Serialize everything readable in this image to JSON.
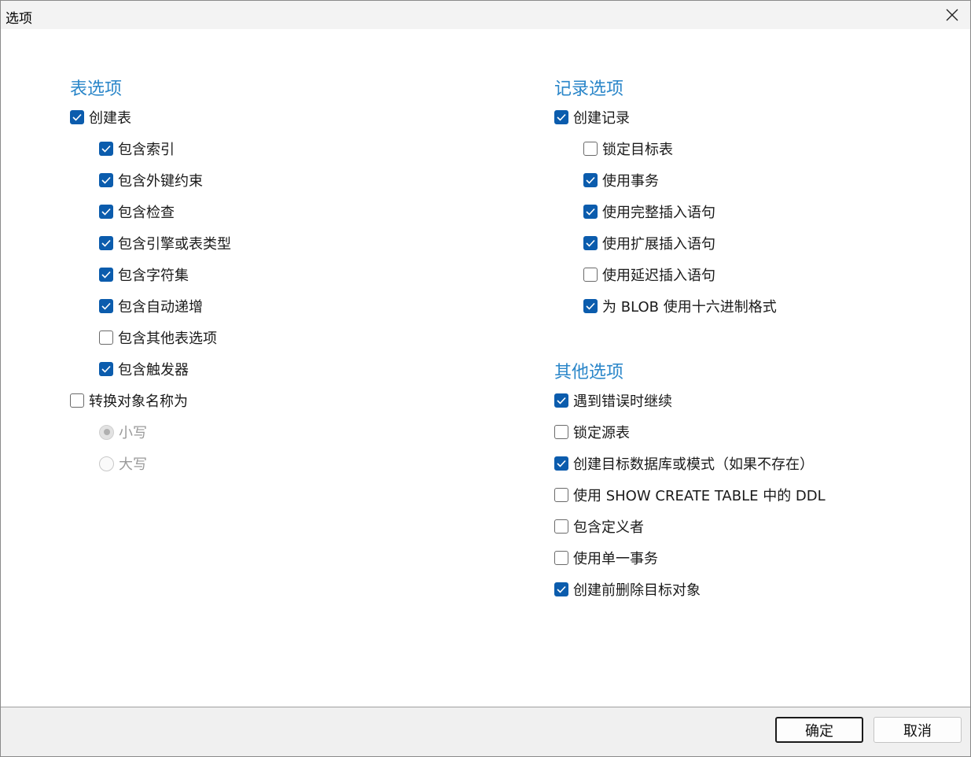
{
  "window": {
    "title": "选项"
  },
  "table_options": {
    "title": "表选项",
    "create_table": {
      "label": "创建表",
      "checked": true
    },
    "sub": [
      {
        "label": "包含索引",
        "checked": true
      },
      {
        "label": "包含外键约束",
        "checked": true
      },
      {
        "label": "包含检查",
        "checked": true
      },
      {
        "label": "包含引擎或表类型",
        "checked": true
      },
      {
        "label": "包含字符集",
        "checked": true
      },
      {
        "label": "包含自动递增",
        "checked": true
      },
      {
        "label": "包含其他表选项",
        "checked": false
      },
      {
        "label": "包含触发器",
        "checked": true
      }
    ],
    "convert_names": {
      "label": "转换对象名称为",
      "checked": false
    },
    "case_options": [
      {
        "label": "小写",
        "selected": true
      },
      {
        "label": "大写",
        "selected": false
      }
    ]
  },
  "record_options": {
    "title": "记录选项",
    "create_records": {
      "label": "创建记录",
      "checked": true
    },
    "sub": [
      {
        "label": "锁定目标表",
        "checked": false
      },
      {
        "label": "使用事务",
        "checked": true
      },
      {
        "label": "使用完整插入语句",
        "checked": true
      },
      {
        "label": "使用扩展插入语句",
        "checked": true
      },
      {
        "label": "使用延迟插入语句",
        "checked": false
      },
      {
        "label": "为 BLOB 使用十六进制格式",
        "checked": true
      }
    ]
  },
  "other_options": {
    "title": "其他选项",
    "items": [
      {
        "label": "遇到错误时继续",
        "checked": true
      },
      {
        "label": "锁定源表",
        "checked": false
      },
      {
        "label": "创建目标数据库或模式（如果不存在）",
        "checked": true
      },
      {
        "label": "使用 SHOW CREATE TABLE 中的 DDL",
        "checked": false
      },
      {
        "label": "包含定义者",
        "checked": false
      },
      {
        "label": "使用单一事务",
        "checked": false
      },
      {
        "label": "创建前删除目标对象",
        "checked": true
      }
    ]
  },
  "footer": {
    "ok_label": "确定",
    "cancel_label": "取消"
  },
  "colors": {
    "accent": "#0b5cad",
    "section_title": "#2a86c9"
  }
}
